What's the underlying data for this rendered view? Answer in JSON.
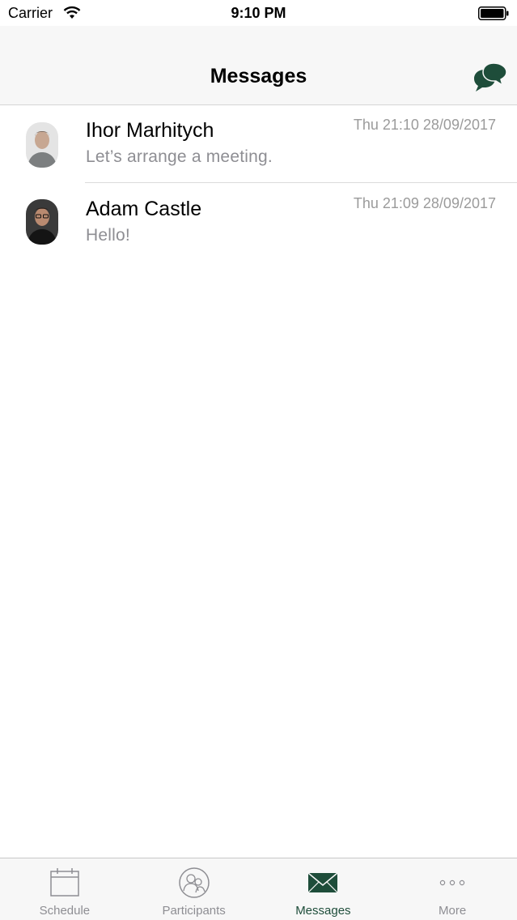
{
  "status_bar": {
    "carrier": "Carrier",
    "time": "9:10 PM"
  },
  "nav": {
    "title": "Messages",
    "compose_icon": "chat-bubbles-icon"
  },
  "conversations": [
    {
      "name": "Ihor Marhitych",
      "preview": "Let’s arrange a meeting.",
      "timestamp": "Thu 21:10 28/09/2017",
      "avatar": "avatar-photo-light"
    },
    {
      "name": "Adam Castle",
      "preview": "Hello!",
      "timestamp": "Thu 21:09 28/09/2017",
      "avatar": "avatar-photo-dark"
    }
  ],
  "tabs": [
    {
      "label": "Schedule",
      "icon": "calendar-icon",
      "active": false
    },
    {
      "label": "Participants",
      "icon": "participants-icon",
      "active": false
    },
    {
      "label": "Messages",
      "icon": "envelope-icon",
      "active": true
    },
    {
      "label": "More",
      "icon": "more-dots-icon",
      "active": false
    }
  ],
  "colors": {
    "accent": "#1e4d3a",
    "inactive_tab": "#8e8e93",
    "secondary_text": "#8e8e93",
    "nav_background": "#f7f7f7"
  }
}
